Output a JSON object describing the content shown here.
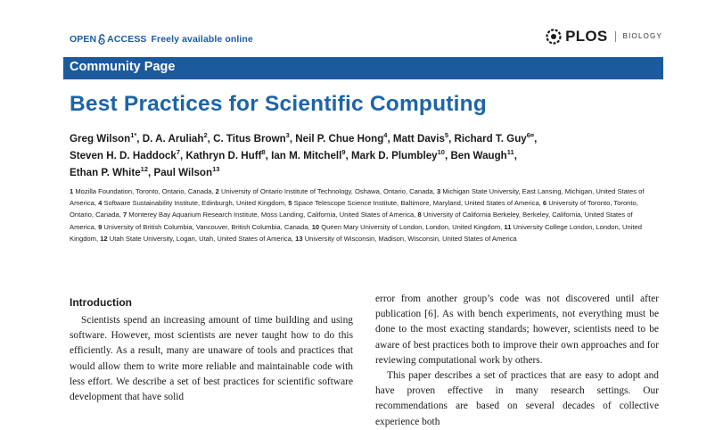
{
  "header": {
    "open": "OPEN",
    "access": "ACCESS",
    "free": "Freely available online",
    "journal_logo": "PLOS",
    "journal_name": "BIOLOGY"
  },
  "section_bar": "Community Page",
  "title": "Best Practices for Scientific Computing",
  "authors": [
    {
      "name": "Greg Wilson",
      "sup": "1*"
    },
    {
      "name": "D. A. Aruliah",
      "sup": "2"
    },
    {
      "name": "C. Titus Brown",
      "sup": "3"
    },
    {
      "name": "Neil P. Chue Hong",
      "sup": "4"
    },
    {
      "name": "Matt Davis",
      "sup": "5"
    },
    {
      "name": "Richard T. Guy",
      "sup": "6¤"
    },
    {
      "name": "Steven H. D. Haddock",
      "sup": "7"
    },
    {
      "name": "Kathryn D. Huff",
      "sup": "8"
    },
    {
      "name": "Ian M. Mitchell",
      "sup": "9"
    },
    {
      "name": "Mark D. Plumbley",
      "sup": "10"
    },
    {
      "name": "Ben Waugh",
      "sup": "11"
    },
    {
      "name": "Ethan P. White",
      "sup": "12"
    },
    {
      "name": "Paul Wilson",
      "sup": "13"
    }
  ],
  "affiliations": [
    {
      "num": "1",
      "text": "Mozilla Foundation, Toronto, Ontario, Canada,"
    },
    {
      "num": "2",
      "text": "University of Ontario Institute of Technology, Oshawa, Ontario, Canada,"
    },
    {
      "num": "3",
      "text": "Michigan State University, East Lansing, Michigan, United States of America,"
    },
    {
      "num": "4",
      "text": "Software Sustainability Institute, Edinburgh, United Kingdom,"
    },
    {
      "num": "5",
      "text": "Space Telescope Science Institute, Baltimore, Maryland, United States of America,"
    },
    {
      "num": "6",
      "text": "University of Toronto, Toronto, Ontario, Canada,"
    },
    {
      "num": "7",
      "text": "Monterey Bay Aquarium Research Institute, Moss Landing, California, United States of America,"
    },
    {
      "num": "8",
      "text": "University of California Berkeley, Berkeley, California, United States of America,"
    },
    {
      "num": "9",
      "text": "University of British Columbia, Vancouver, British Columbia, Canada,"
    },
    {
      "num": "10",
      "text": "Queen Mary University of London, London, United Kingdom,"
    },
    {
      "num": "11",
      "text": "University College London, London, United Kingdom,"
    },
    {
      "num": "12",
      "text": "Utah State University, Logan, Utah, United States of America,"
    },
    {
      "num": "13",
      "text": "University of Wisconsin, Madison, Wisconsin, United States of America"
    }
  ],
  "introduction": {
    "heading": "Introduction",
    "col1_p1": "Scientists spend an increasing amount of time building and using software. However, most scientists are never taught how to do this efficiently. As a result, many are unaware of tools and practices that would allow them to write more reliable and maintainable code with less effort. We describe a set of best practices for scientific software development that have solid",
    "col2_p1": "error from another group’s code was not discovered until after publication [6]. As with bench experiments, not everything must be done to the most exacting standards; however, scientists need to be aware of best practices both to improve their own approaches and for reviewing computational work by others.",
    "col2_p2": "This paper describes a set of practices that are easy to adopt and have proven effective in many research settings. Our recommendations are based on several decades of collective experience both"
  }
}
